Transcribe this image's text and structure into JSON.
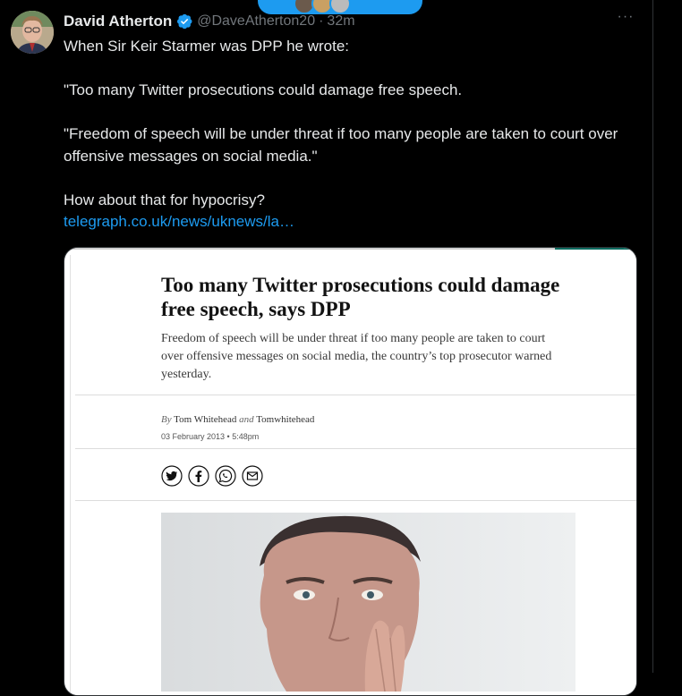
{
  "tweet": {
    "author_name": "David Atherton",
    "handle": "@DaveAtherton20",
    "separator": "·",
    "time": "32m",
    "lines": [
      "When Sir Keir Starmer was DPP he wrote:",
      "\"Too many Twitter prosecutions could damage free speech.",
      "\"Freedom of speech will be under threat if too many people are taken to court over offensive messages on social media.\"",
      "How about that for hypocrisy?"
    ],
    "link": "telegraph.co.uk/news/uknews/la…"
  },
  "card": {
    "headline": "Too many Twitter prosecutions could damage free speech, says DPP",
    "standfirst": "Freedom of speech will be under threat if too many people are taken to court over offensive messages on social media, the country’s top prosecutor warned yesterday.",
    "by_prefix": "By",
    "author1": "Tom Whitehead",
    "conjunction": "and",
    "author2": "Tomwhitehead",
    "date": "03 February 2013 • 5:48pm"
  },
  "icons": {
    "verified": "verified-badge-icon",
    "more": "more-icon",
    "share": [
      "twitter-icon",
      "facebook-icon",
      "whatsapp-icon",
      "email-icon"
    ]
  },
  "colors": {
    "background": "#000000",
    "accent": "#1d9bf0",
    "text": "#e7e9ea",
    "muted": "#71767b"
  }
}
